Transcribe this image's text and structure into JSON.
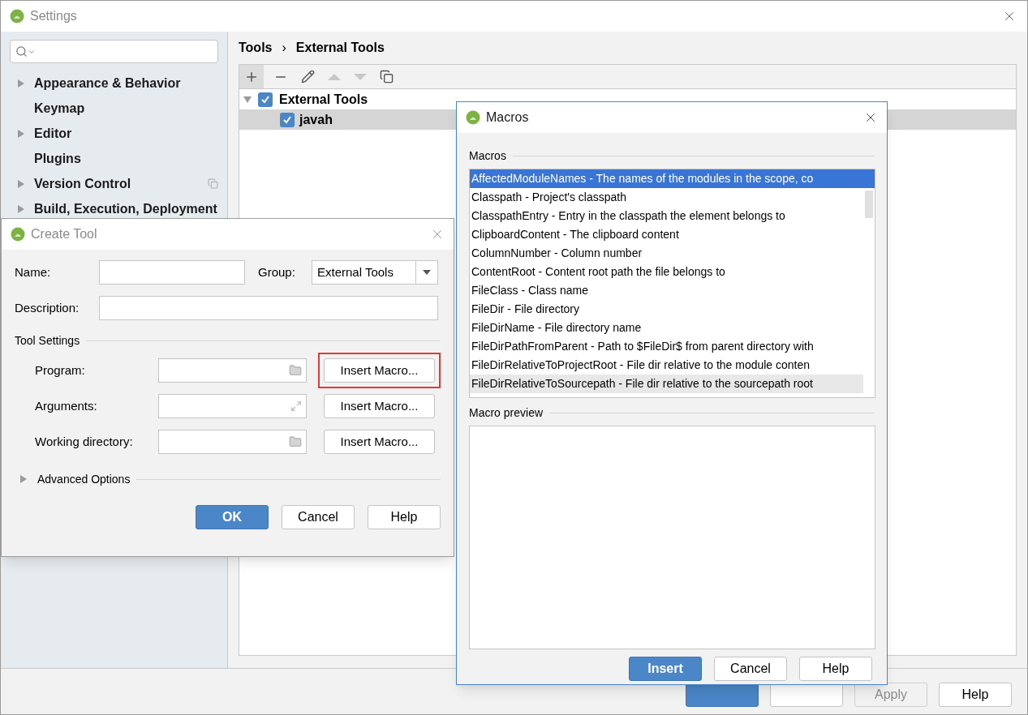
{
  "settings_window": {
    "title": "Settings",
    "sidebar": {
      "items": [
        {
          "label": "Appearance & Behavior",
          "expandable": true,
          "project_scoped": false
        },
        {
          "label": "Keymap",
          "expandable": false,
          "project_scoped": false
        },
        {
          "label": "Editor",
          "expandable": true,
          "project_scoped": false
        },
        {
          "label": "Plugins",
          "expandable": false,
          "project_scoped": false
        },
        {
          "label": "Version Control",
          "expandable": true,
          "project_scoped": true
        },
        {
          "label": "Build, Execution, Deployment",
          "expandable": true,
          "project_scoped": false
        }
      ]
    },
    "breadcrumb": {
      "items": [
        "Tools",
        "External Tools"
      ],
      "separator": "›"
    },
    "tree": [
      {
        "label": "External Tools",
        "checked": true,
        "expanded": true,
        "selected": false,
        "children": [
          {
            "label": "javah",
            "checked": true,
            "selected": true
          }
        ]
      }
    ],
    "footer_buttons": [
      {
        "kind": "primary",
        "disabled": false
      },
      {
        "kind": "default",
        "disabled": false
      },
      {
        "label": "Apply",
        "kind": "default",
        "disabled": true
      },
      {
        "label": "Help",
        "kind": "default",
        "disabled": false
      }
    ]
  },
  "create_tool_dialog": {
    "title": "Create Tool",
    "name_label": "Name:",
    "group_label": "Group:",
    "group_value": "External Tools",
    "description_label": "Description:",
    "section_label": "Tool Settings",
    "settings_rows": [
      {
        "label": "Program:",
        "kind": "browse",
        "button": "Insert Macro...",
        "highlighted": true
      },
      {
        "label": "Arguments:",
        "kind": "expand",
        "button": "Insert Macro...",
        "highlighted": false
      },
      {
        "label": "Working directory:",
        "kind": "browse",
        "button": "Insert Macro...",
        "highlighted": false
      }
    ],
    "advanced": {
      "label": "Advanced Options",
      "expanded": false
    },
    "buttons": [
      {
        "label": "OK",
        "kind": "primary"
      },
      {
        "label": "Cancel",
        "kind": "default"
      },
      {
        "label": "Help",
        "kind": "default"
      }
    ]
  },
  "macros_dialog": {
    "title": "Macros",
    "list_label": "Macros",
    "items": [
      {
        "text": "AffectedModuleNames - The names of the modules in the scope, co",
        "selected": true
      },
      {
        "text": "Classpath - Project's classpath",
        "selected": false
      },
      {
        "text": "ClasspathEntry - Entry in the classpath the element belongs to",
        "selected": false
      },
      {
        "text": "ClipboardContent - The clipboard content",
        "selected": false
      },
      {
        "text": "ColumnNumber - Column number",
        "selected": false
      },
      {
        "text": "ContentRoot - Content root path the file belongs to",
        "selected": false
      },
      {
        "text": "FileClass - Class name",
        "selected": false
      },
      {
        "text": "FileDir - File directory",
        "selected": false
      },
      {
        "text": "FileDirName - File directory name",
        "selected": false
      },
      {
        "text": "FileDirPathFromParent - Path to $FileDir$ from parent directory with",
        "selected": false
      },
      {
        "text": "FileDirRelativeToProjectRoot - File dir relative to the module conten",
        "selected": false
      },
      {
        "text": "FileDirRelativeToSourcepath - File dir relative to the sourcepath root",
        "selected": false,
        "hovered": true
      }
    ],
    "preview_label": "Macro preview",
    "buttons": [
      {
        "label": "Insert",
        "kind": "primary"
      },
      {
        "label": "Cancel",
        "kind": "default"
      },
      {
        "label": "Help",
        "kind": "default"
      }
    ]
  }
}
